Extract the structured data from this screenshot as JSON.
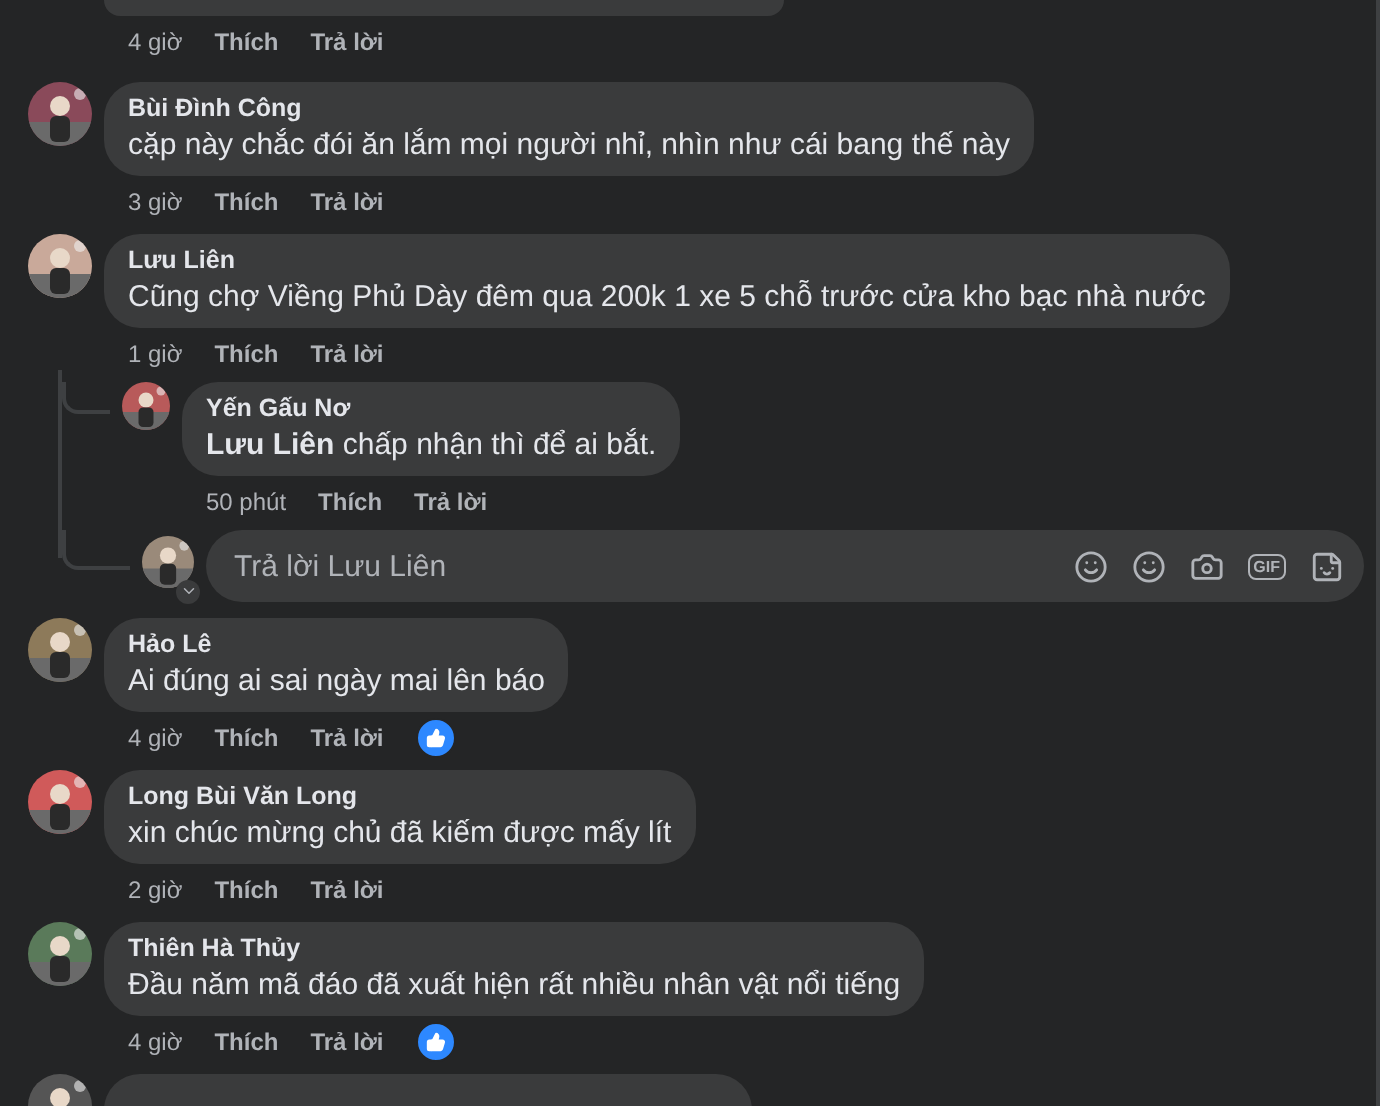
{
  "top_meta": {
    "time": "4 giờ",
    "like": "Thích",
    "reply": "Trả lời"
  },
  "comments": [
    {
      "name": "Bùi Đình Công",
      "text": "cặp này chắc đói ăn lắm mọi người nhỉ, nhìn như cái bang thế này",
      "time": "3 giờ",
      "like": "Thích",
      "reply": "Trả lời",
      "liked": false
    },
    {
      "name": "Lưu Liên",
      "text": "Cũng chợ Viềng Phủ Dày đêm qua 200k 1 xe 5 chỗ trước cửa kho bạc nhà nước",
      "time": "1 giờ",
      "like": "Thích",
      "reply": "Trả lời",
      "liked": false,
      "replies": [
        {
          "name": "Yến Gấu Nơ",
          "text": "**Lưu Liên** chấp nhận thì để ai bắt.",
          "time": "50 phút",
          "like": "Thích",
          "reply": "Trả lời"
        }
      ],
      "composer": {
        "placeholder": "Trả lời Lưu Liên",
        "gif": "GIF"
      }
    },
    {
      "name": "Hảo Lê",
      "text": "Ai đúng ai sai ngày mai lên báo",
      "time": "4 giờ",
      "like": "Thích",
      "reply": "Trả lời",
      "liked": true
    },
    {
      "name": "Long Bùi Văn Long",
      "text": "xin chúc mừng chủ đã kiếm được mấy lít",
      "time": "2 giờ",
      "like": "Thích",
      "reply": "Trả lời",
      "liked": false
    },
    {
      "name": "Thiên Hà Thủy",
      "text": "Đầu năm mã đáo đã xuất hiện rất nhiều nhân vật nổi tiếng",
      "time": "4 giờ",
      "like": "Thích",
      "reply": "Trả lời",
      "liked": true
    }
  ]
}
